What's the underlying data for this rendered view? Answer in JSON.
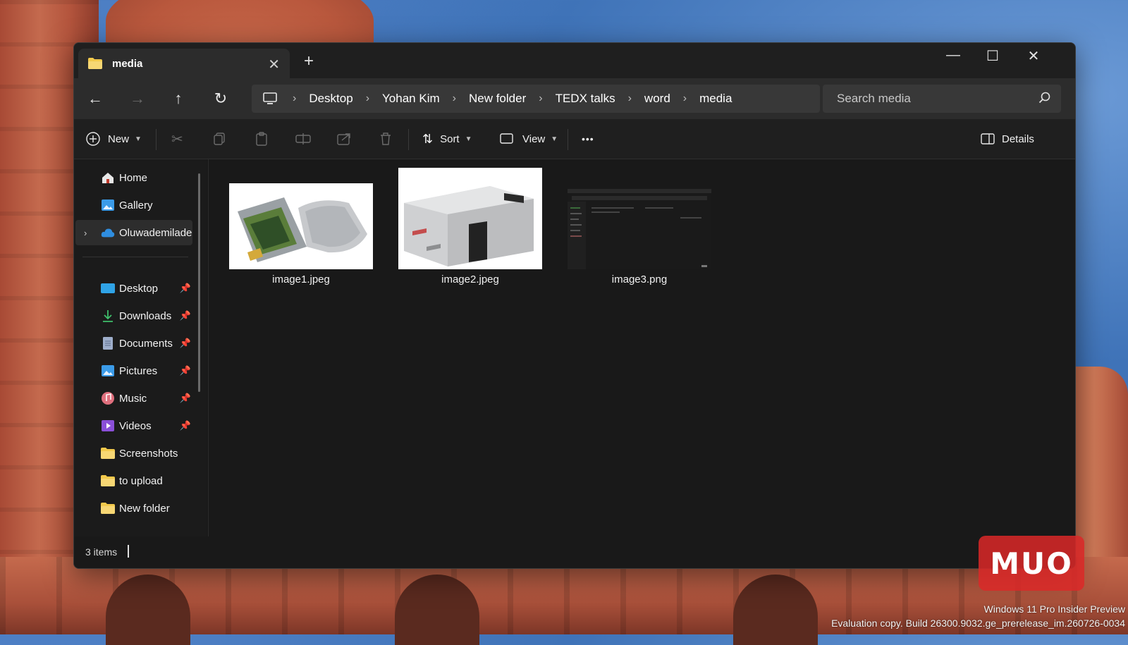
{
  "window": {
    "tab_title": "media",
    "new_tab": "+",
    "minimize": "—",
    "maximize": "☐",
    "close": "✕"
  },
  "nav": {
    "breadcrumb": [
      "Desktop",
      "Yohan Kim",
      "New folder",
      "TEDX talks",
      "word",
      "media"
    ],
    "search_placeholder": "Search media"
  },
  "toolbar": {
    "new_label": "New",
    "sort_label": "Sort",
    "view_label": "View",
    "more_label": "•••",
    "details_label": "Details"
  },
  "sidebar": {
    "top_items": [
      {
        "label": "Home",
        "icon": "home-icon"
      },
      {
        "label": "Gallery",
        "icon": "gallery-icon"
      },
      {
        "label": "Oluwademilade",
        "icon": "cloud-icon"
      }
    ],
    "pinned_items": [
      {
        "label": "Desktop",
        "icon": "desktop-folder-icon"
      },
      {
        "label": "Downloads",
        "icon": "download-icon"
      },
      {
        "label": "Documents",
        "icon": "documents-icon"
      },
      {
        "label": "Pictures",
        "icon": "pictures-icon"
      },
      {
        "label": "Music",
        "icon": "music-icon"
      },
      {
        "label": "Videos",
        "icon": "videos-icon"
      }
    ],
    "folders": [
      {
        "label": "Screenshots"
      },
      {
        "label": "to upload"
      },
      {
        "label": "New folder"
      }
    ]
  },
  "files": [
    {
      "name": "image1.jpeg"
    },
    {
      "name": "image2.jpeg"
    },
    {
      "name": "image3.png"
    }
  ],
  "status": {
    "item_count": "3 items"
  },
  "desktop": {
    "watermark_line1": "Windows 11 Pro Insider Preview",
    "watermark_line2": "Evaluation copy. Build 26300.9032.ge_prerelease_im.260726-0034",
    "logo": "MUO"
  },
  "colors": {
    "window_bg": "#191919",
    "navbar_bg": "#2c2c2c",
    "folder_yellow": "#f2c94c",
    "accent_blue": "#3b9be8"
  }
}
